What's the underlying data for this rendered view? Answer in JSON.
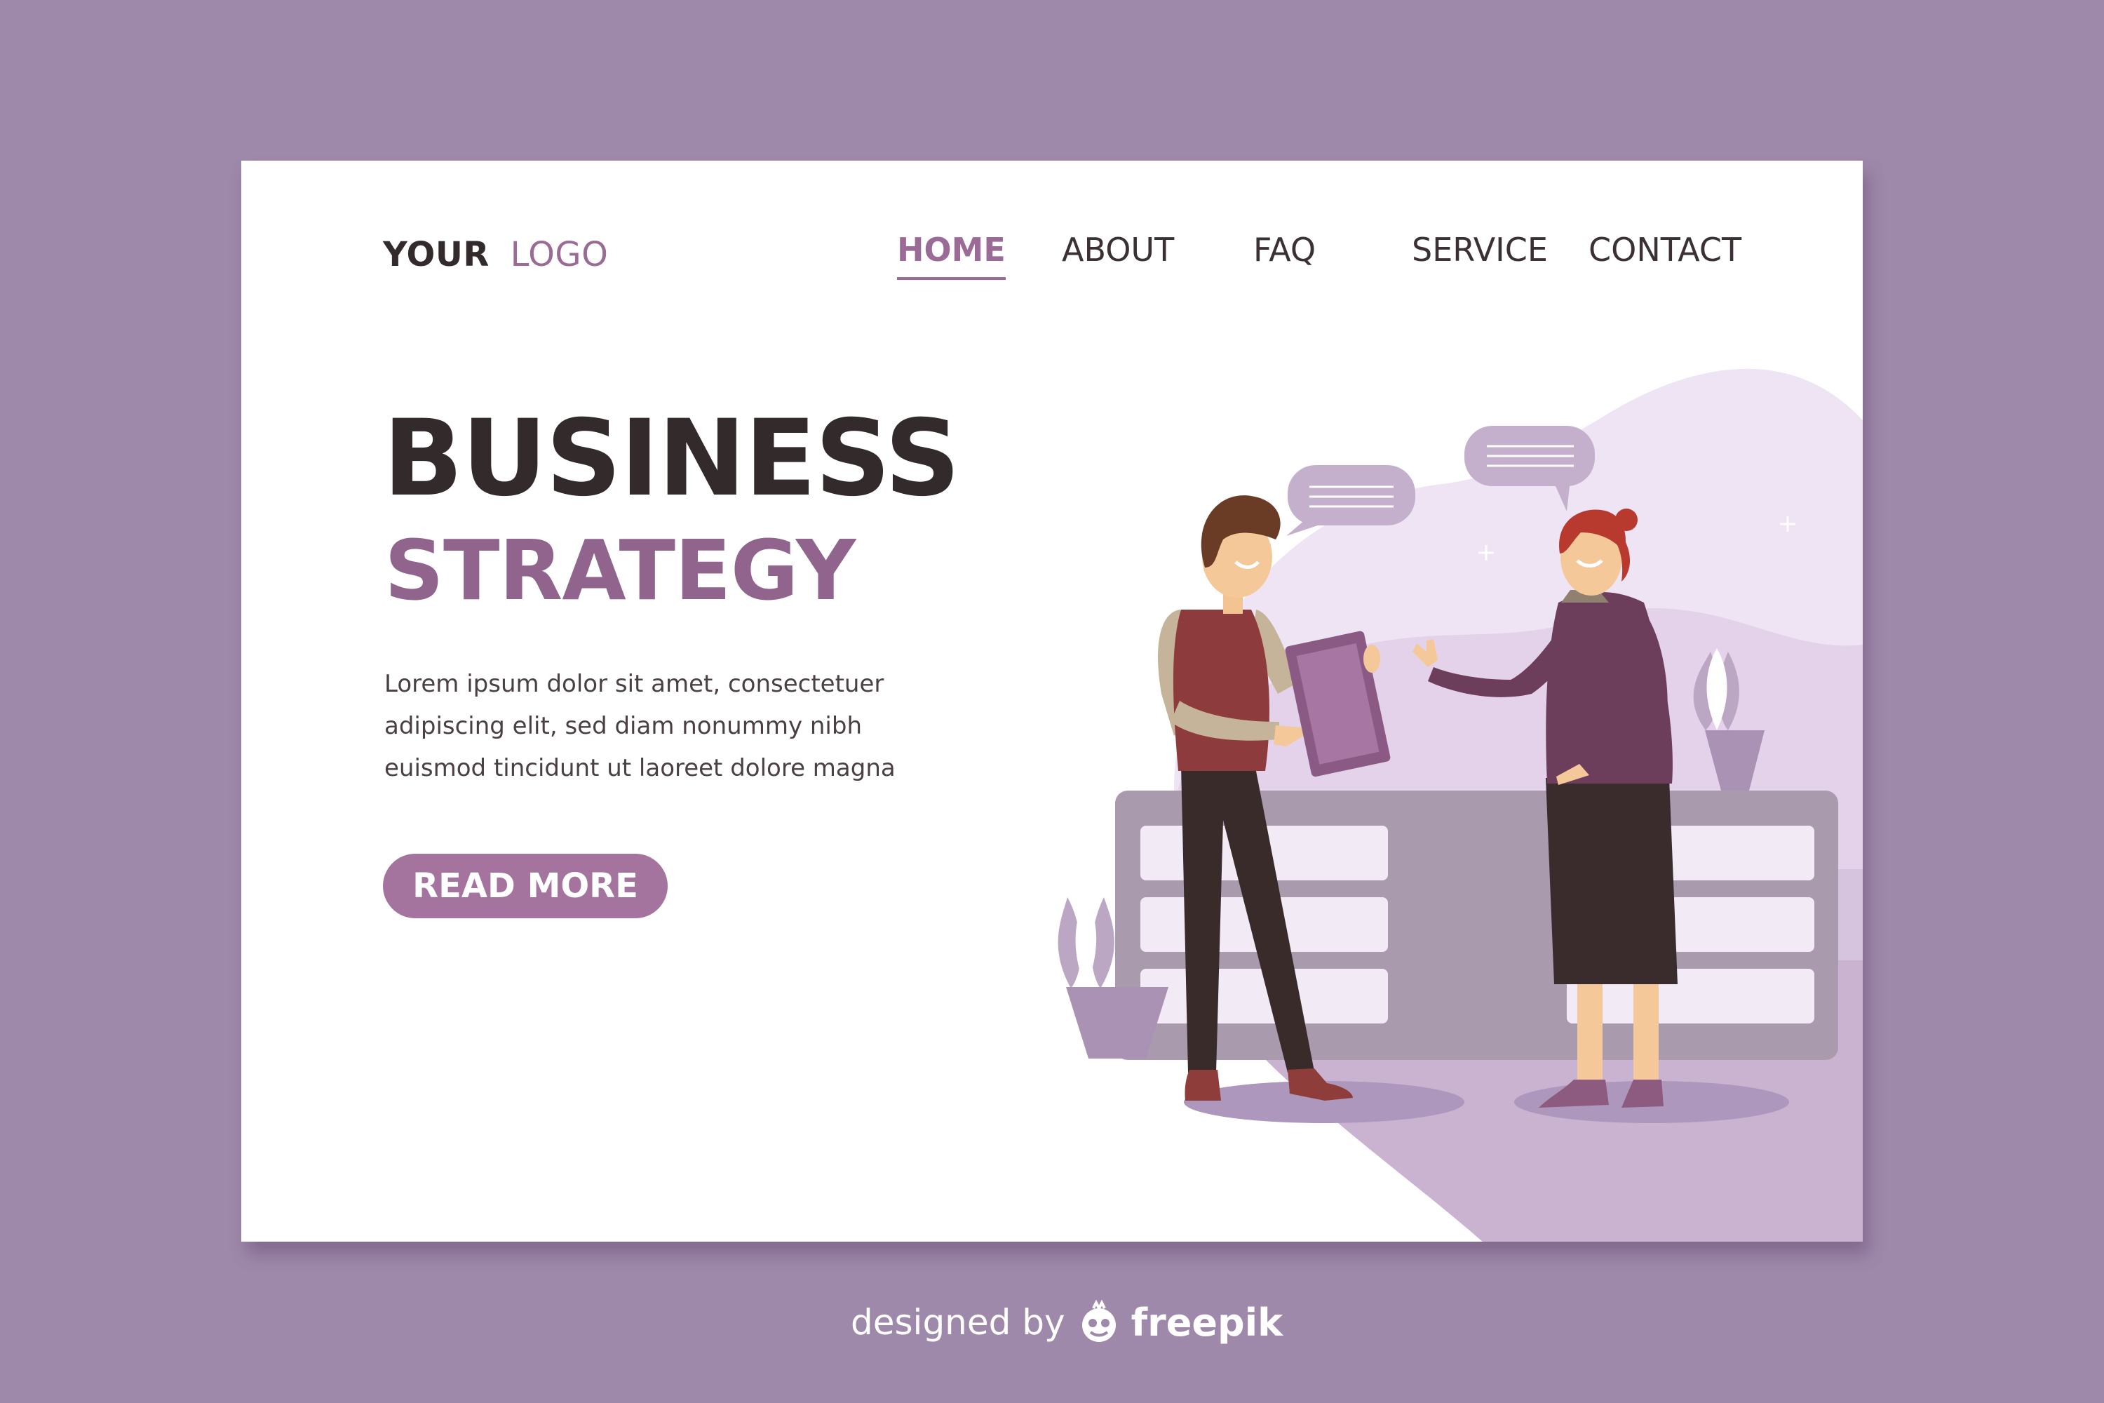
{
  "logo": {
    "bold": "YOUR",
    "light": "LOGO"
  },
  "nav": {
    "items": [
      {
        "label": "HOME",
        "active": true
      },
      {
        "label": "ABOUT"
      },
      {
        "label": "FAQ"
      },
      {
        "label": "SERVICE"
      },
      {
        "label": "CONTACT"
      }
    ]
  },
  "hero": {
    "title": "BUSINESS",
    "subtitle": "STRATEGY",
    "body": "Lorem ipsum dolor sit amet, consectetuer adipiscing elit, sed diam nonummy nibh euismod tincidunt ut laoreet dolore magna",
    "cta_label": "READ MORE"
  },
  "credit": {
    "prefix": "designed by",
    "brand": "freepik"
  },
  "colors": {
    "background": "#9e89ab",
    "card": "#ffffff",
    "accent": "#a4749f",
    "title": "#332a2c",
    "subtitle": "#91648d"
  },
  "icons": {
    "credit": "freepik-icon",
    "speech_bubbles": "speech-bubble-icon",
    "plants": "potted-plant-icon",
    "sparkles": "sparkle-icon"
  }
}
